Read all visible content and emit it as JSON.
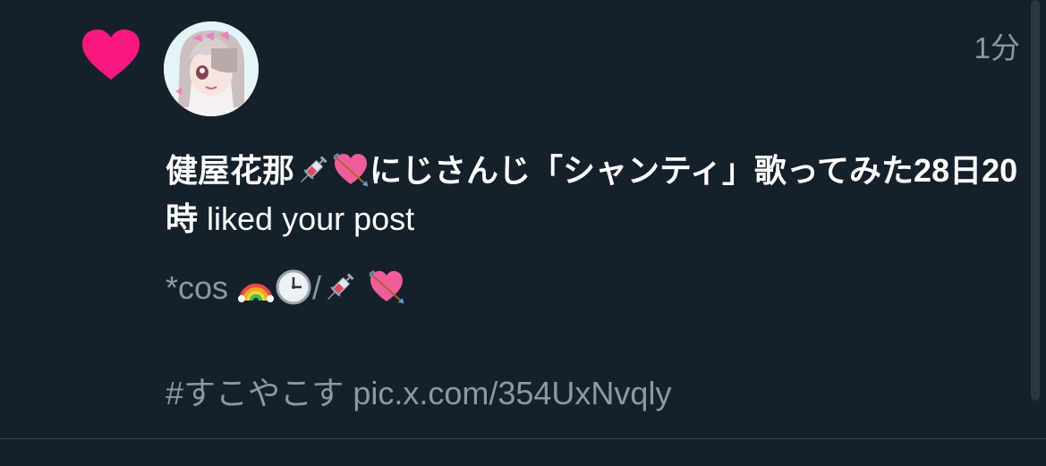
{
  "notification": {
    "type_icon": "heart-icon",
    "accent_color": "#f91880",
    "timestamp": "1分",
    "user_display_name_prefix": "健屋花那",
    "user_display_name_suffix": "にじさんじ「シャンティ」歌ってみた28日20時",
    "display_name_emojis": [
      "syringe-emoji",
      "heart-with-arrow-emoji"
    ],
    "action_text": "liked your post",
    "post_text_part1": "*cos",
    "post_text_emojis": [
      "rainbow-emoji",
      "clock-emoji",
      "syringe-emoji",
      "heart-with-arrow-emoji"
    ],
    "post_text_separator": "/",
    "post_text_hashtag": "#すこやこす",
    "post_text_link": "pic.x.com/354UxNvqly"
  },
  "theme": {
    "background": "#15202b",
    "primary_text": "#ffffff",
    "secondary_text": "#8b98a5",
    "divider": "#38444d"
  }
}
